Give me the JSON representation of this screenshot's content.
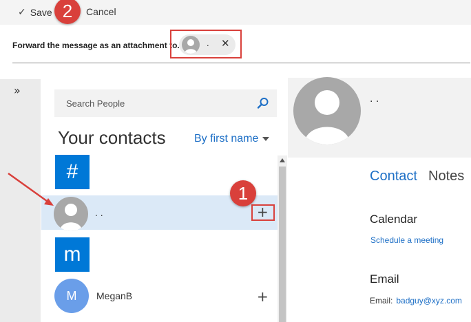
{
  "toolbar": {
    "save_label": "Save",
    "cancel_label": "Cancel"
  },
  "forward": {
    "label": "Forward the message as an attachment to..",
    "recipient_name": ".",
    "remove_glyph": "✕"
  },
  "rail": {
    "expand_glyph": "»"
  },
  "people": {
    "search_placeholder": "Search People",
    "title": "Your contacts",
    "sort_label": "By first name",
    "groups": [
      {
        "letter": "#",
        "contacts": [
          {
            "name": ". ."
          }
        ]
      },
      {
        "letter": "m",
        "contacts": [
          {
            "name": "MeganB",
            "initial": "M"
          }
        ]
      }
    ],
    "add_glyph": "+"
  },
  "details": {
    "name": ". .",
    "tabs": [
      "Contact",
      "Notes"
    ],
    "calendar_title": "Calendar",
    "schedule_link": "Schedule a meeting",
    "email_title": "Email",
    "email_label": "Email:",
    "email_value": "badguy@xyz.com"
  },
  "annotations": {
    "step_1": "1",
    "step_2": "2"
  },
  "colors": {
    "accent_blue": "#0078d7",
    "link_blue": "#1d6fc6",
    "annotation_red": "#d9403b",
    "selected_row": "#dbe9f7"
  },
  "icons": [
    "checkmark-icon",
    "search-icon",
    "person-icon",
    "close-icon",
    "expand-icon",
    "plus-icon",
    "caret-down-icon",
    "scroll-up-icon"
  ]
}
